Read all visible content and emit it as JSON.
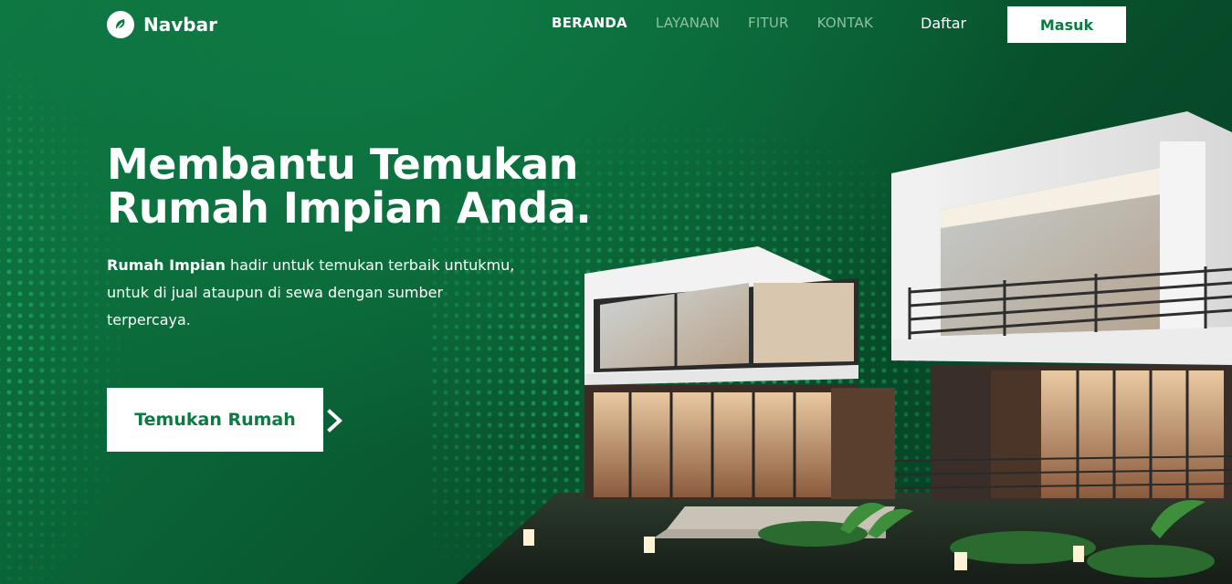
{
  "nav": {
    "brand": "Navbar",
    "links": [
      {
        "label": "BERANDA",
        "active": true
      },
      {
        "label": "LAYANAN",
        "active": false
      },
      {
        "label": "FITUR",
        "active": false
      },
      {
        "label": "KONTAK",
        "active": false
      }
    ],
    "daftar_label": "Daftar",
    "masuk_label": "Masuk"
  },
  "hero": {
    "headline_line1": "Membantu Temukan",
    "headline_line2": "Rumah Impian Anda.",
    "desc_bold": "Rumah Impian",
    "desc_rest": " hadir untuk temukan terbaik untukmu, untuk di jual ataupun di sewa dengan sumber terpercaya.",
    "cta_label": "Temukan Rumah"
  },
  "icons": {
    "brand": "leaf-logo-icon",
    "cta_arrow": "chevron-right-icon"
  },
  "colors": {
    "primary_green": "#0d7a44",
    "dark_green": "#053b21",
    "white": "#ffffff",
    "nav_inactive": "#8fbfa4"
  }
}
